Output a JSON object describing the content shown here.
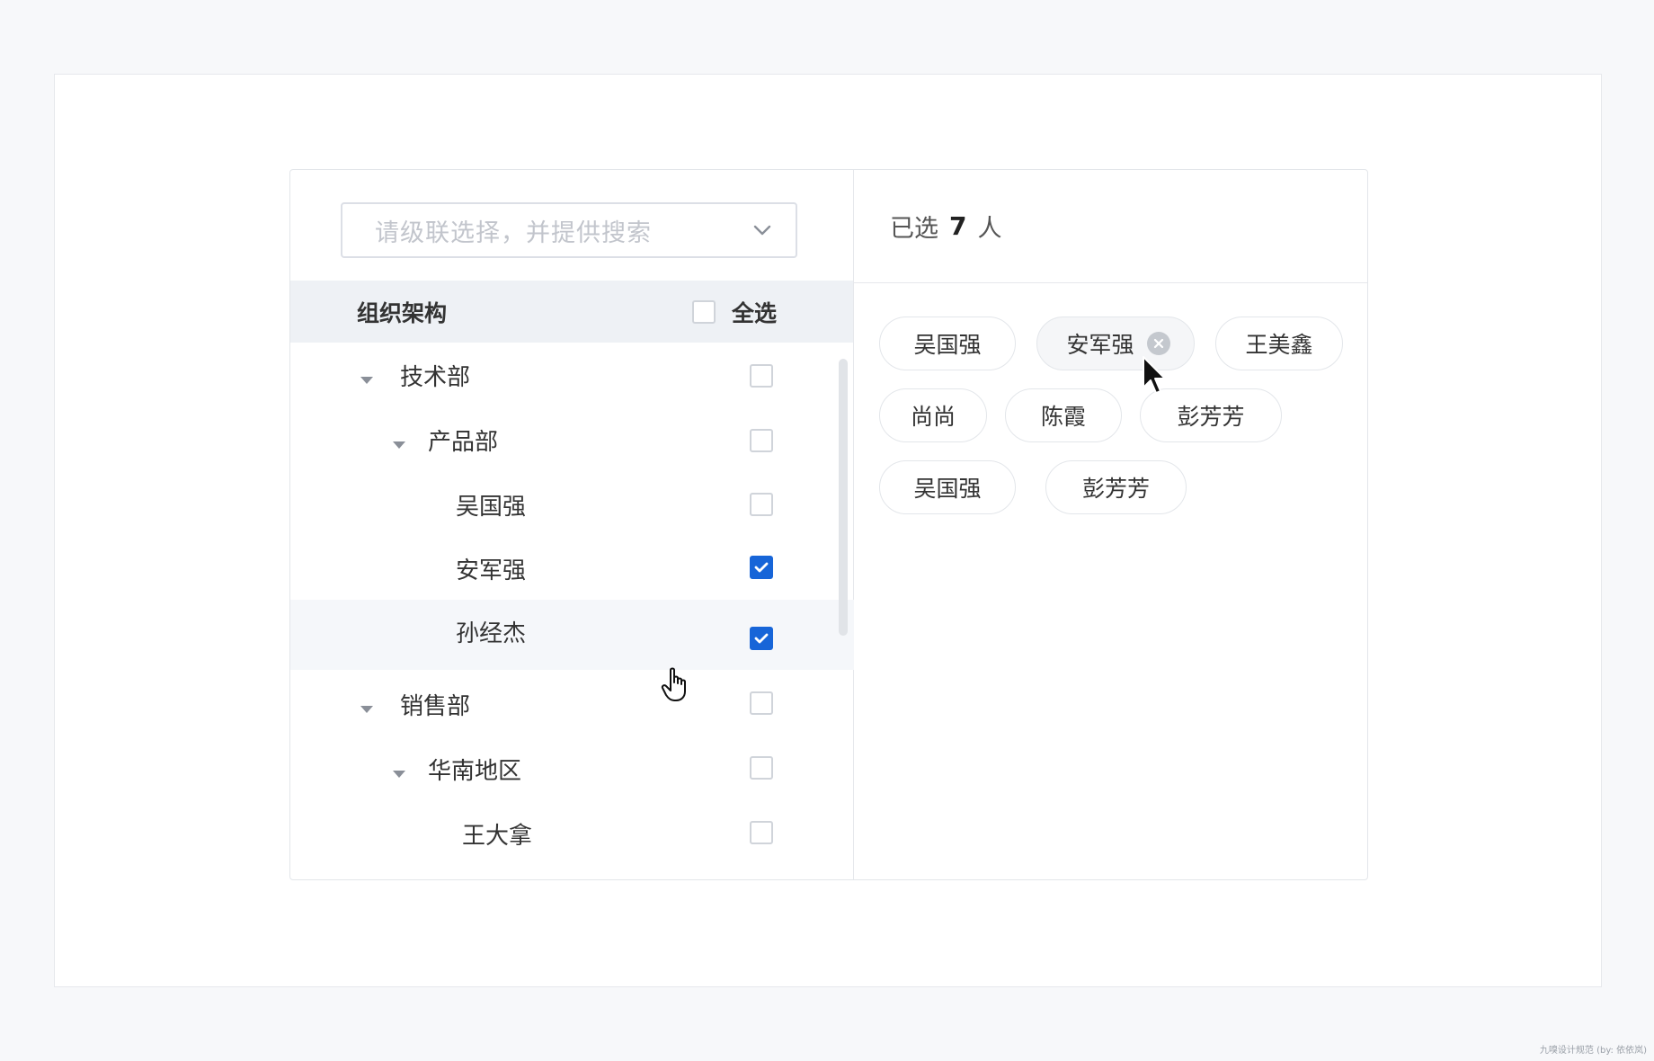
{
  "search": {
    "placeholder": "请级联选择，并提供搜索",
    "chevron_icon": "chevron-down-icon"
  },
  "tree": {
    "header_title": "组织架构",
    "select_all_label": "全选",
    "select_all_checked": false,
    "rows": [
      {
        "label": "技术部",
        "level": 0,
        "expanded": true,
        "checked": false,
        "type": "department"
      },
      {
        "label": "产品部",
        "level": 1,
        "expanded": true,
        "checked": false,
        "type": "department"
      },
      {
        "label": "吴国强",
        "level": 2,
        "checked": false,
        "type": "person"
      },
      {
        "label": "安军强",
        "level": 2,
        "checked": true,
        "type": "person"
      },
      {
        "label": "孙经杰",
        "level": 2,
        "checked": true,
        "type": "person",
        "hovered": true
      },
      {
        "label": "销售部",
        "level": 0,
        "expanded": true,
        "checked": false,
        "type": "department"
      },
      {
        "label": "华南地区",
        "level": 1,
        "expanded": true,
        "checked": false,
        "type": "department"
      },
      {
        "label": "王大拿",
        "level": 2,
        "checked": false,
        "type": "person"
      }
    ]
  },
  "selected": {
    "prefix": "已选",
    "count": "7",
    "suffix": "人",
    "chips": [
      {
        "label": "吴国强"
      },
      {
        "label": "安军强",
        "hovered": true,
        "remove_icon": "close-circle-icon"
      },
      {
        "label": "王美鑫"
      },
      {
        "label": "尚尚"
      },
      {
        "label": "陈霞"
      },
      {
        "label": "彭芳芳"
      },
      {
        "label": "吴国强"
      },
      {
        "label": "彭芳芳"
      }
    ]
  },
  "colors": {
    "accent": "#1765d8",
    "header_bg": "#eef1f5",
    "border": "#e3e6ea"
  },
  "watermark": "九嗅设计规范 (by: 依依岚)"
}
